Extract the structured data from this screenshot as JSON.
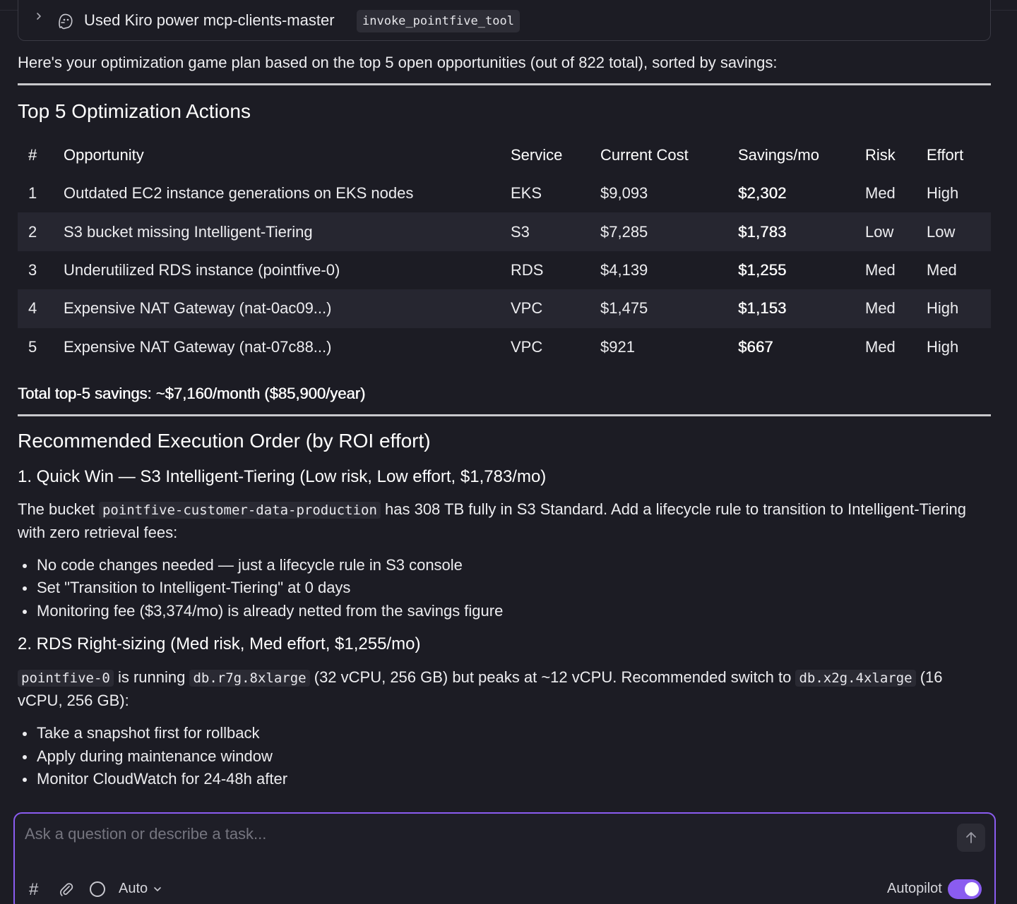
{
  "tool_call": {
    "label": "Used Kiro power mcp-clients-master",
    "tool_name": "invoke_pointfive_tool"
  },
  "intro": "Here's your optimization game plan based on the top 5 open opportunities (out of 822 total), sorted by savings:",
  "section1": {
    "title": "Top 5 Optimization Actions",
    "columns": [
      "#",
      "Opportunity",
      "Service",
      "Current Cost",
      "Savings/mo",
      "Risk",
      "Effort"
    ],
    "rows": [
      {
        "num": "1",
        "opportunity": "Outdated EC2 instance generations on EKS nodes",
        "service": "EKS",
        "cost": "$9,093",
        "savings": "$2,302",
        "risk": "Med",
        "effort": "High"
      },
      {
        "num": "2",
        "opportunity": "S3 bucket missing Intelligent-Tiering",
        "service": "S3",
        "cost": "$7,285",
        "savings": "$1,783",
        "risk": "Low",
        "effort": "Low"
      },
      {
        "num": "3",
        "opportunity": "Underutilized RDS instance (pointfive-0)",
        "service": "RDS",
        "cost": "$4,139",
        "savings": "$1,255",
        "risk": "Med",
        "effort": "Med"
      },
      {
        "num": "4",
        "opportunity": "Expensive NAT Gateway (nat-0ac09...)",
        "service": "VPC",
        "cost": "$1,475",
        "savings": "$1,153",
        "risk": "Med",
        "effort": "High"
      },
      {
        "num": "5",
        "opportunity": "Expensive NAT Gateway (nat-07c88...)",
        "service": "VPC",
        "cost": "$921",
        "savings": "$667",
        "risk": "Med",
        "effort": "High"
      }
    ],
    "total": "Total top-5 savings: ~$7,160/month ($85,900/year)"
  },
  "section2": {
    "title": "Recommended Execution Order (by ROI effort)",
    "step1": {
      "title": "1. Quick Win — S3 Intelligent-Tiering (Low risk, Low effort, $1,783/mo)",
      "p_before": "The bucket ",
      "p_code": "pointfive-customer-data-production",
      "p_after": " has 308 TB fully in S3 Standard. Add a lifecycle rule to transition to Intelligent-Tiering with zero retrieval fees:",
      "bullets": [
        "No code changes needed — just a lifecycle rule in S3 console",
        "Set \"Transition to Intelligent-Tiering\" at 0 days",
        "Monitoring fee ($3,374/mo) is already netted from the savings figure"
      ]
    },
    "step2": {
      "title": "2. RDS Right-sizing (Med risk, Med effort, $1,255/mo)",
      "code1": "pointfive-0",
      "text1": " is running ",
      "code2": "db.r7g.8xlarge",
      "text2": " (32 vCPU, 256 GB) but peaks at ~12 vCPU. Recommended switch to ",
      "code3": "db.x2g.4xlarge",
      "text3": " (16 vCPU, 256 GB):",
      "bullets": [
        "Take a snapshot first for rollback",
        "Apply during maintenance window",
        "Monitor CloudWatch for 24-48h after"
      ]
    }
  },
  "composer": {
    "placeholder": "Ask a question or describe a task...",
    "hash_symbol": "#",
    "mode": "Auto",
    "autopilot_label": "Autopilot",
    "autopilot_on": true,
    "accent_color": "#8a5cf0"
  },
  "icons": [
    "chevron-right-icon",
    "kiro-ghost-icon",
    "send-arrow-icon",
    "hash-icon",
    "paperclip-icon",
    "circle-icon",
    "chevron-down-icon"
  ]
}
